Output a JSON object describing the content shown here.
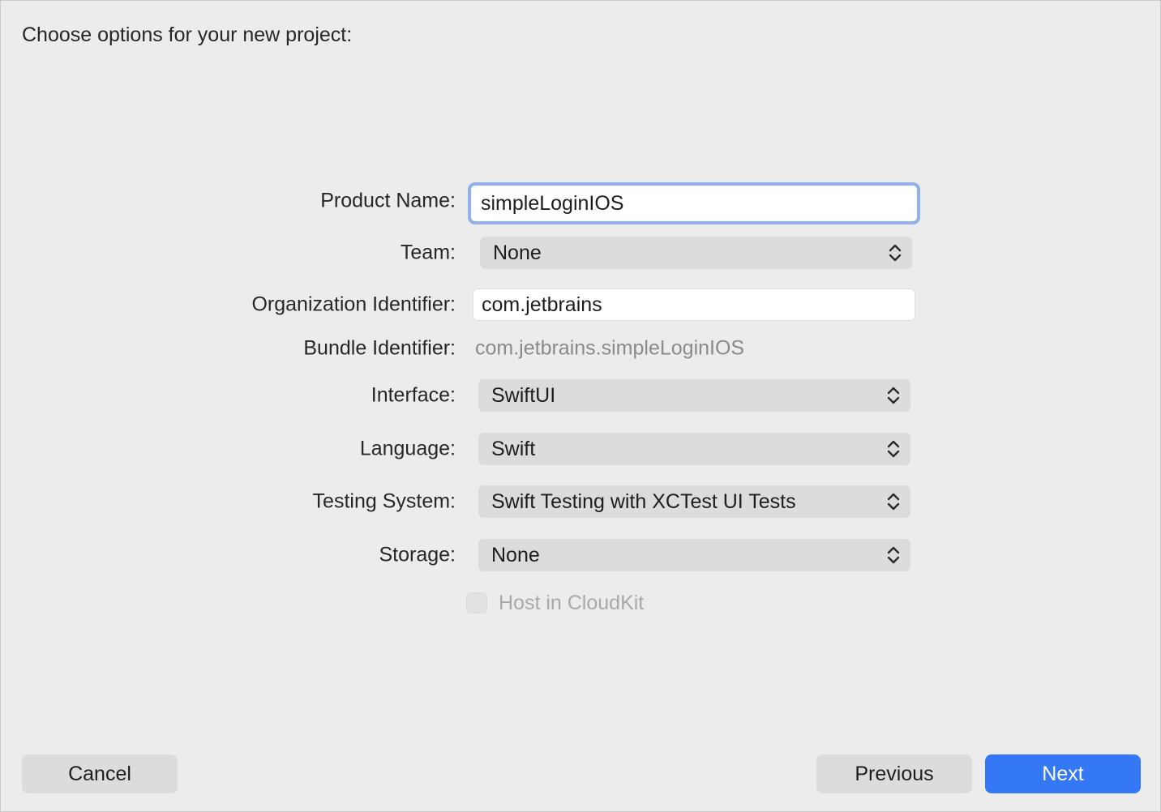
{
  "dialog": {
    "heading": "Choose options for your new project:"
  },
  "form": {
    "product_name": {
      "label": "Product Name:",
      "value": "simpleLoginIOS"
    },
    "team": {
      "label": "Team:",
      "value": "None"
    },
    "organization_identifier": {
      "label": "Organization Identifier:",
      "value": "com.jetbrains"
    },
    "bundle_identifier": {
      "label": "Bundle Identifier:",
      "value": "com.jetbrains.simpleLoginIOS"
    },
    "interface": {
      "label": "Interface:",
      "value": "SwiftUI"
    },
    "language": {
      "label": "Language:",
      "value": "Swift"
    },
    "testing_system": {
      "label": "Testing System:",
      "value": "Swift Testing with XCTest UI Tests"
    },
    "storage": {
      "label": "Storage:",
      "value": "None"
    },
    "host_in_cloudkit": {
      "label": "Host in CloudKit",
      "checked": false,
      "enabled": false
    }
  },
  "buttons": {
    "cancel": "Cancel",
    "previous": "Previous",
    "next": "Next"
  },
  "colors": {
    "accent": "#3478f6",
    "focus_ring": "#8fb0ea",
    "background": "#ececec"
  },
  "icons": {
    "popup_indicator": "chevron-up-down-icon"
  }
}
